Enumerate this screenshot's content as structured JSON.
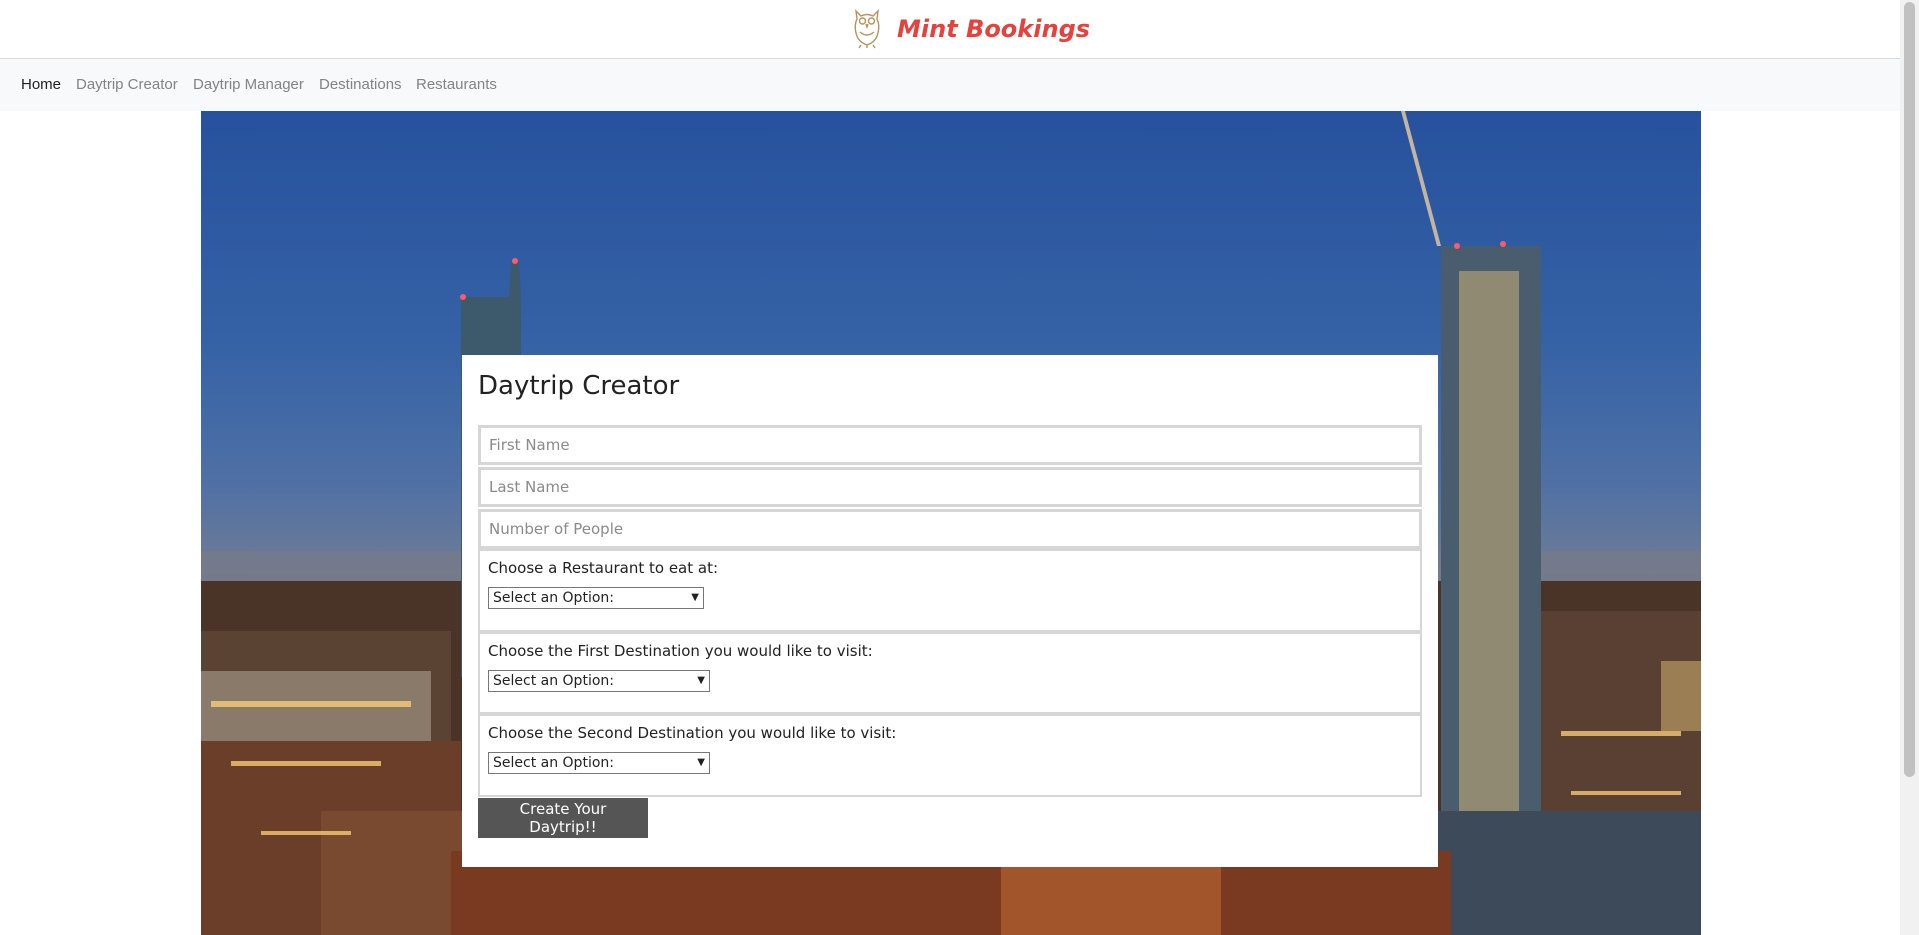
{
  "brand": {
    "name": "Mint Bookings",
    "logo_icon": "owl-icon"
  },
  "nav": {
    "items": [
      {
        "label": "Home",
        "active": true
      },
      {
        "label": "Daytrip Creator",
        "active": false
      },
      {
        "label": "Daytrip Manager",
        "active": false
      },
      {
        "label": "Destinations",
        "active": false
      },
      {
        "label": "Restaurants",
        "active": false
      }
    ]
  },
  "form": {
    "title": "Daytrip Creator",
    "first_name": {
      "placeholder": "First Name",
      "value": ""
    },
    "last_name": {
      "placeholder": "Last Name",
      "value": ""
    },
    "people": {
      "placeholder": "Number of People",
      "value": ""
    },
    "restaurant": {
      "label": "Choose a Restaurant to eat at:",
      "selected": "Select an Option:"
    },
    "destination1": {
      "label": "Choose the First Destination you would like to visit:",
      "selected": "Select an Option:"
    },
    "destination2": {
      "label": "Choose the Second Destination you would like to visit:",
      "selected": "Select an Option:"
    },
    "submit_label": "Create Your Daytrip!!"
  },
  "colors": {
    "brand": "#e8413b",
    "button": "#555555",
    "nav_bg": "#f8f9fa"
  }
}
